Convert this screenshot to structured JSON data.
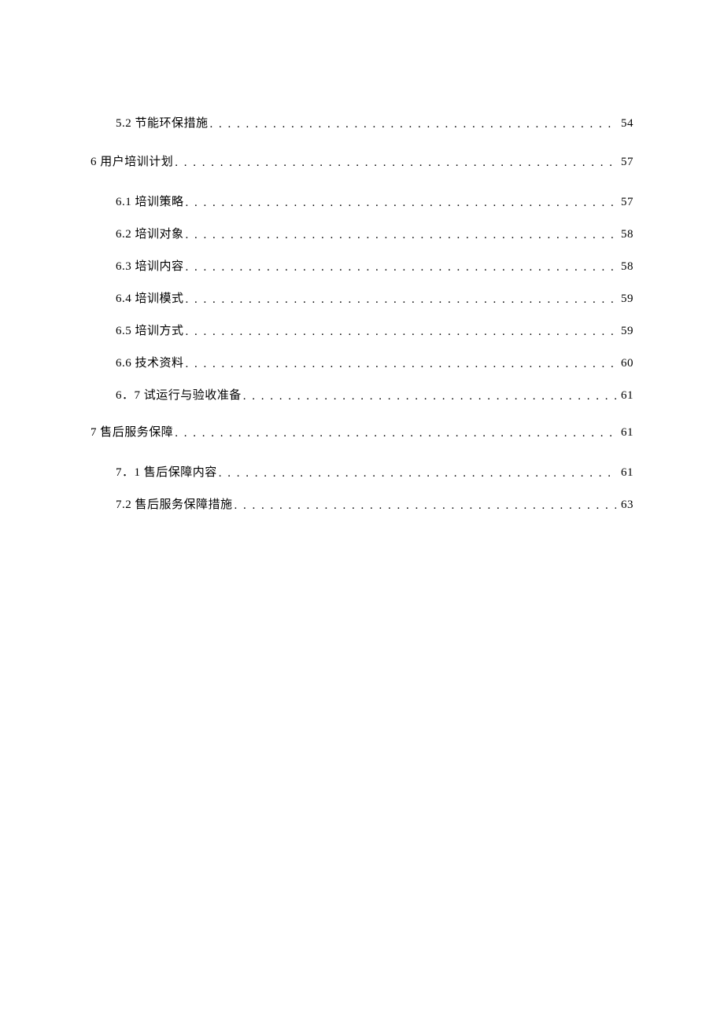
{
  "toc": {
    "entries": [
      {
        "level": 2,
        "title": "5.2 节能环保措施",
        "page": "54",
        "group": "5"
      },
      {
        "level": 1,
        "title": "6 用户培训计划",
        "page": "57",
        "group": "6"
      },
      {
        "level": 2,
        "title": "6.1 培训策略",
        "page": "57",
        "group": "6"
      },
      {
        "level": 2,
        "title": "6.2 培训对象",
        "page": "58",
        "group": "6"
      },
      {
        "level": 2,
        "title": "6.3 培训内容",
        "page": "58",
        "group": "6"
      },
      {
        "level": 2,
        "title": "6.4 培训模式",
        "page": "59",
        "group": "6"
      },
      {
        "level": 2,
        "title": "6.5 培训方式",
        "page": "59",
        "group": "6"
      },
      {
        "level": 2,
        "title": "6.6 技术资料",
        "page": "60",
        "group": "6"
      },
      {
        "level": 2,
        "title": "6．7 试运行与验收准备",
        "page": "61",
        "group": "6"
      },
      {
        "level": 1,
        "title": "7 售后服务保障",
        "page": "61",
        "group": "7",
        "italic_prefix": true
      },
      {
        "level": 2,
        "title": "7．1 售后保障内容",
        "page": "61",
        "group": "7"
      },
      {
        "level": 2,
        "title": "7.2 售后服务保障措施",
        "page": "63",
        "group": "7"
      }
    ]
  }
}
